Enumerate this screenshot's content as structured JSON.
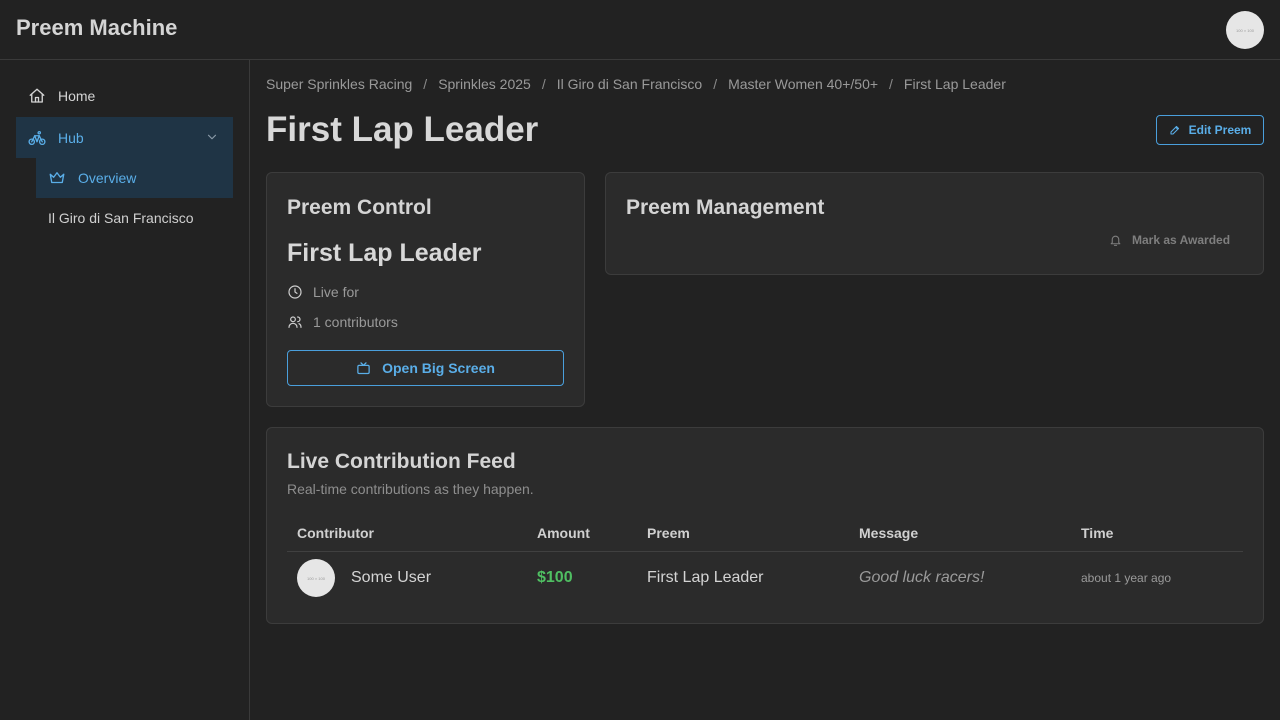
{
  "app": {
    "title": "Preem Machine",
    "avatar_text": "100 × 100"
  },
  "sidebar": {
    "items": [
      {
        "label": "Home",
        "icon": "home-icon"
      },
      {
        "label": "Hub",
        "icon": "bike-icon"
      },
      {
        "label": "Overview",
        "icon": "crown-icon"
      },
      {
        "label": "Il Giro di San Francisco"
      }
    ]
  },
  "breadcrumb": [
    "Super Sprinkles Racing",
    "Sprinkles 2025",
    "Il Giro di San Francisco",
    "Master Women 40+/50+",
    "First Lap Leader"
  ],
  "page": {
    "title": "First Lap Leader",
    "edit_label": "Edit Preem"
  },
  "control": {
    "title": "Preem Control",
    "preem_name": "First Lap Leader",
    "live_label": "Live for",
    "contributors_label": "1 contributors",
    "big_screen_label": "Open Big Screen"
  },
  "management": {
    "title": "Preem Management",
    "awarded_label": "Mark as Awarded"
  },
  "feed": {
    "title": "Live Contribution Feed",
    "description": "Real-time contributions as they happen.",
    "columns": [
      "Contributor",
      "Amount",
      "Preem",
      "Message",
      "Time"
    ],
    "rows": [
      {
        "avatar_text": "100 × 100",
        "contributor": "Some User",
        "amount": "$100",
        "preem": "First Lap Leader",
        "message": "Good luck racers!",
        "time": "about 1 year ago"
      }
    ]
  },
  "colors": {
    "accent": "#5aaee8",
    "amount": "#4fbf62",
    "background": "#222222",
    "card": "#2b2b2b"
  }
}
